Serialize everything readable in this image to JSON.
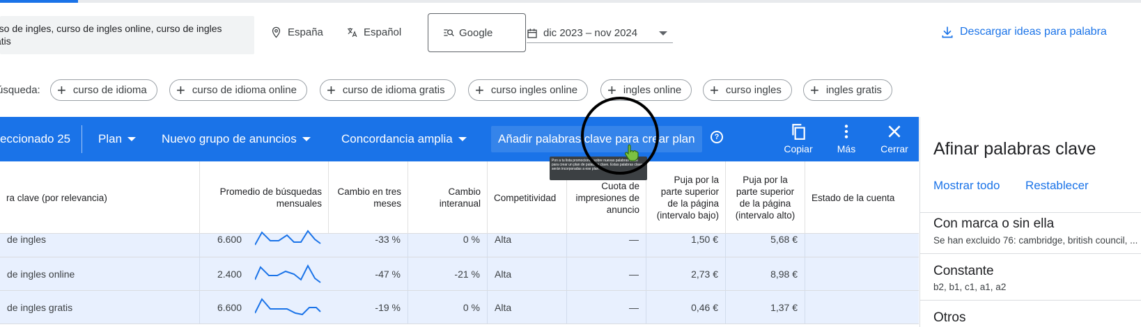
{
  "search": {
    "keywords_line1": "rso de ingles, curso de ingles online, curso de ingles",
    "keywords_line2": "atis"
  },
  "filters": {
    "location": "España",
    "language": "Español",
    "network": "Google",
    "date_range": "dic 2023 – nov 2024",
    "download_label": "Descargar ideas para palabra"
  },
  "suggestions": {
    "label": "úsqueda:",
    "chips": [
      "curso de idioma",
      "curso de idioma online",
      "curso de idioma gratis",
      "curso ingles online",
      "ingles online",
      "curso ingles",
      "ingles gratis"
    ]
  },
  "toolbar": {
    "selected": "eccionado 25",
    "plan": "Plan",
    "ad_group": "Nuevo grupo de anuncios",
    "match": "Concordancia amplia",
    "add_keywords": "Añadir palabras clave para crear plan",
    "help_icon": "?",
    "copy": "Copiar",
    "more": "Más",
    "close": "Cerrar"
  },
  "tooltip_text": "Pon a tu lista promociones sobre nuevas palabras clave para crear un plan de palabras clave. Estas palabras clave serán incorporadas a ese plan.",
  "table": {
    "headers": {
      "keyword": "ra clave (por relevancia)",
      "avg_searches": "Promedio de búsquedas mensuales",
      "three_month": "Cambio en tres meses",
      "yoy": "Cambio interanual",
      "competition": "Competitividad",
      "impression_share": "Cuota de impresiones de anuncio",
      "bid_low": "Puja por la parte superior de la página (intervalo bajo)",
      "bid_high": "Puja por la parte superior de la página (intervalo alto)",
      "account_status": "Estado de la cuenta"
    },
    "rows": [
      {
        "keyword": "de ingles",
        "avg": "6.600",
        "three_month": "-33 %",
        "yoy": "0 %",
        "competition": "Alta",
        "share": "—",
        "bid_low": "1,50 €",
        "bid_high": "5,68 €"
      },
      {
        "keyword": "de ingles online",
        "avg": "2.400",
        "three_month": "-47 %",
        "yoy": "-21 %",
        "competition": "Alta",
        "share": "—",
        "bid_low": "2,73 €",
        "bid_high": "8,98 €"
      },
      {
        "keyword": "de ingles gratis",
        "avg": "6.600",
        "three_month": "-19 %",
        "yoy": "0 %",
        "competition": "Alta",
        "share": "—",
        "bid_low": "0,46 €",
        "bid_high": "1,37 €"
      }
    ]
  },
  "refine_panel": {
    "title": "Afinar palabras clave",
    "show_all": "Mostrar todo",
    "reset": "Restablecer",
    "sections": [
      {
        "title": "Con marca o sin ella",
        "subtitle": "Se han excluido 76: cambridge, british council, ..."
      },
      {
        "title": "Constante",
        "subtitle": "b2, b1, c1, a1, a2"
      },
      {
        "title": "Otros",
        "subtitle": ""
      }
    ]
  },
  "colors": {
    "accent": "#1a73e8",
    "row_selected": "#e8f0fe"
  }
}
